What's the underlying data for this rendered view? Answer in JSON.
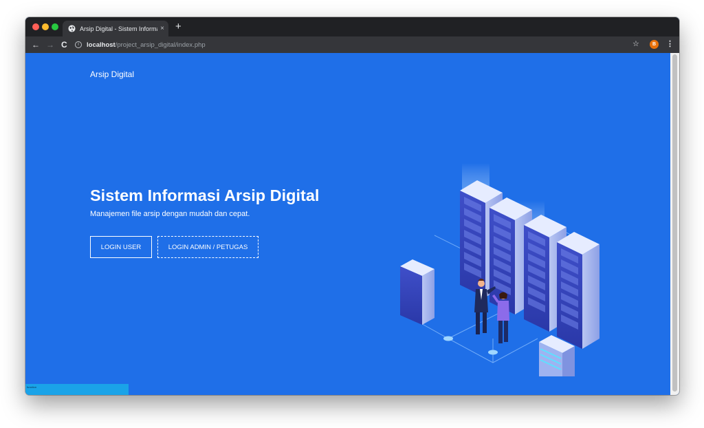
{
  "browser": {
    "tab": {
      "title": "Arsip Digital - Sistem Informasi A",
      "close_icon": "×",
      "favicon": "globe-icon"
    },
    "new_tab_icon": "+",
    "nav": {
      "back_icon": "←",
      "forward_icon": "→",
      "reload_icon": "C"
    },
    "address": {
      "host": "localhost",
      "path": "/project_arsip_digital/index.php",
      "info_icon": "i"
    },
    "star_icon": "☆",
    "profile_initial": "B",
    "menu_icon": "⋮"
  },
  "page": {
    "brand": "Arsip Digital",
    "hero": {
      "title": "Sistem Informasi Arsip Digital",
      "subtitle": "Manajemen file arsip dengan mudah dan cepat."
    },
    "buttons": {
      "login_user": "LOGIN USER",
      "login_admin": "LOGIN ADMIN / PETUGAS"
    },
    "debug_text": "function"
  },
  "colors": {
    "page_background": "#1f6fe8",
    "chrome_dark": "#202124",
    "chrome_toolbar": "#35363a",
    "profile": "#e8710a",
    "debug_bar": "#1aa3e8"
  }
}
